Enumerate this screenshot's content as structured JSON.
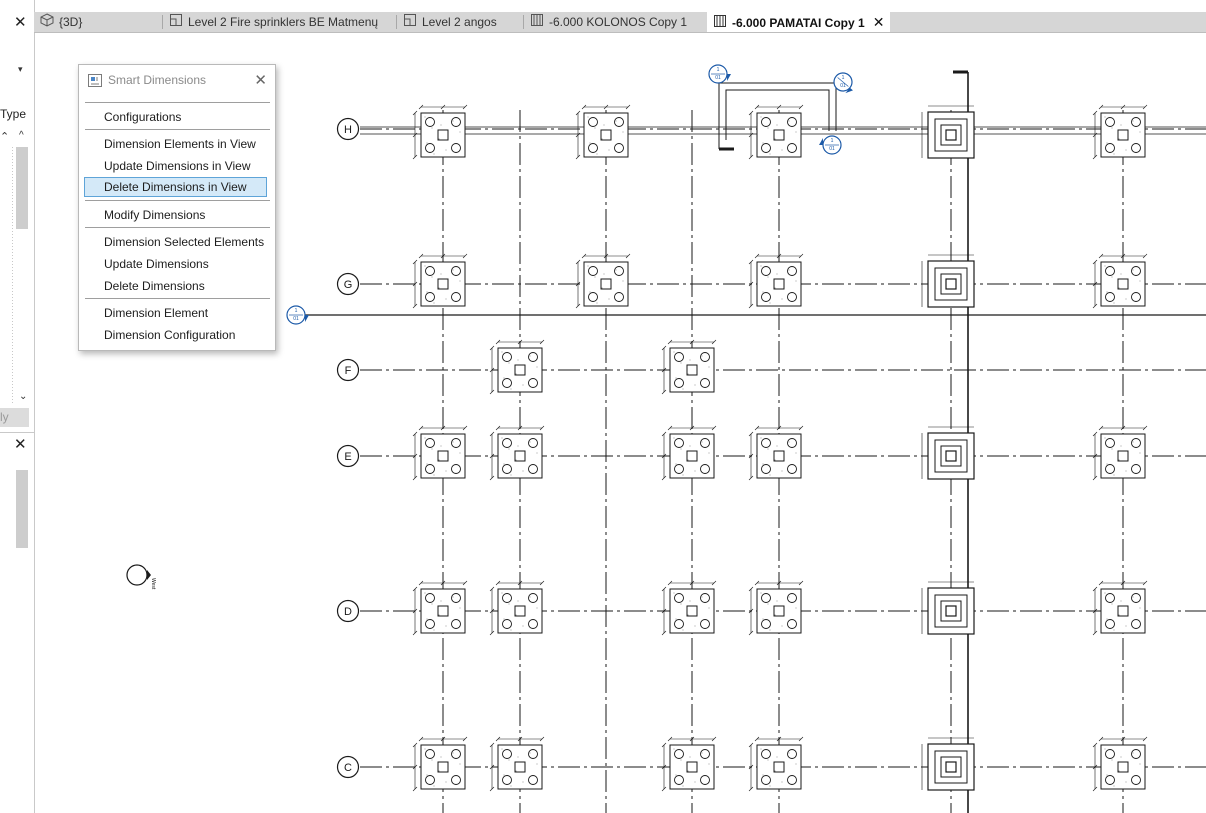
{
  "left_panel": {
    "close_top": "✕",
    "dropdown_arrow": "▾",
    "type_label": "Type",
    "scroll_up_double": "⌃",
    "scroll_up": "^",
    "scroll_down": "⌄",
    "apply_label": "ly",
    "close_bottom": "✕"
  },
  "tabs": [
    {
      "icon": "cube-icon",
      "label": "{3D}",
      "active": false
    },
    {
      "icon": "floor-plan-icon",
      "label": "Level 2 Fire sprinklers BE Matmenų",
      "active": false
    },
    {
      "icon": "floor-plan-icon",
      "label": "Level 2 angos",
      "active": false
    },
    {
      "icon": "structural-plan-icon",
      "label": "-6.000 KOLONOS Copy 1",
      "active": false
    },
    {
      "icon": "structural-plan-icon",
      "label": "-6.000 PAMATAI Copy 1",
      "active": true,
      "close": "✕"
    }
  ],
  "popup": {
    "title": "Smart Dimensions",
    "close": "✕",
    "groups": [
      [
        "Configurations"
      ],
      [
        "Dimension Elements in View",
        "Update Dimensions in View",
        "Delete Dimensions in View"
      ],
      [
        "Modify Dimensions"
      ],
      [
        "Dimension Selected Elements",
        "Update Dimensions",
        "Delete Dimensions"
      ],
      [
        "Dimension Element",
        "Dimension Configuration"
      ]
    ],
    "highlighted": "Delete Dimensions in View"
  },
  "drawing": {
    "grid_rows": [
      "H",
      "G",
      "F",
      "E",
      "D",
      "C"
    ],
    "elevation_label": "West",
    "section_label": "1",
    "section_sheet": "01",
    "colors": {
      "section_marker": "#1c5aa8",
      "lines": "#1a1a1a",
      "tab_bar": "#d6d6d6",
      "highlight": "#d4e9f8"
    }
  }
}
